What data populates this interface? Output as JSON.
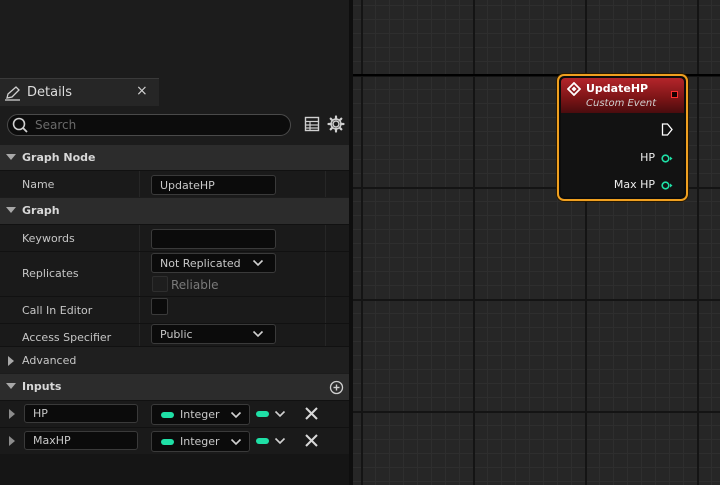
{
  "details_tab": {
    "title": "Details",
    "close": "×"
  },
  "search": {
    "placeholder": "Search",
    "value": ""
  },
  "sections": {
    "graph_node": "Graph Node",
    "graph": "Graph",
    "advanced": "Advanced",
    "inputs": "Inputs"
  },
  "graph_node": {
    "name_label": "Name",
    "name_value": "UpdateHP"
  },
  "graph": {
    "keywords_label": "Keywords",
    "keywords_value": "",
    "replicates_label": "Replicates",
    "replicates_value": "Not Replicated",
    "reliable_label": "Reliable",
    "call_in_editor_label": "Call In Editor",
    "access_specifier_label": "Access Specifier",
    "access_specifier_value": "Public"
  },
  "inputs": [
    {
      "name": "HP",
      "type": "Integer"
    },
    {
      "name": "MaxHP",
      "type": "Integer"
    }
  ],
  "node": {
    "title": "UpdateHP",
    "subtitle": "Custom Event",
    "pins": [
      "HP",
      "Max HP"
    ]
  },
  "colors": {
    "integer_pin": "#1fe0a6",
    "node_border": "#f0a020",
    "node_header": "#b4252a",
    "delegate_pin": "#ff3030"
  }
}
